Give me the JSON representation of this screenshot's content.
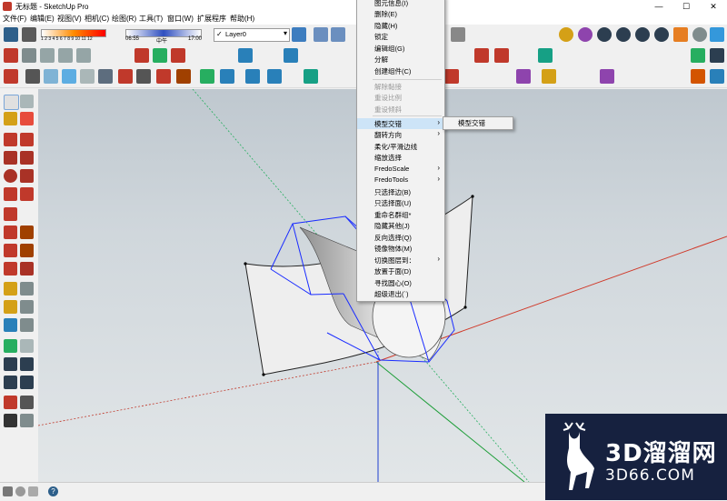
{
  "window": {
    "title": "无标题 - SketchUp Pro",
    "controls": [
      "—",
      "☐",
      "✕"
    ]
  },
  "menubar": {
    "items": [
      "文件(F)",
      "编辑(E)",
      "视图(V)",
      "相机(C)",
      "绘图(R)",
      "工具(T)",
      "窗口(W)",
      "扩展程序",
      "帮助(H)"
    ]
  },
  "toolbar": {
    "layer_name": "Layer0",
    "shadow_months": "1 2 3 4 5 6 7 8 9 10 11 12",
    "shadow_time_start": "06:55",
    "shadow_time_mid": "中午",
    "shadow_time_end": "17:00"
  },
  "context_menu": {
    "items": [
      {
        "label": "图元信息(I)",
        "disabled": false
      },
      {
        "label": "删除(E)",
        "disabled": false
      },
      {
        "label": "隐藏(H)",
        "disabled": false
      },
      {
        "label": "锁定",
        "disabled": false
      },
      {
        "label": "编辑组(G)",
        "disabled": false
      },
      {
        "label": "分解",
        "disabled": false
      },
      {
        "label": "创建组件(C)",
        "disabled": false
      },
      {
        "label": "解除黏接",
        "disabled": true
      },
      {
        "label": "重设比例",
        "disabled": true
      },
      {
        "label": "重设倾斜",
        "disabled": true
      },
      {
        "label": "模型交错",
        "disabled": false,
        "submenu": true,
        "highlighted": true
      },
      {
        "label": "翻转方向",
        "disabled": false,
        "submenu": true
      },
      {
        "label": "柔化/平滑边线",
        "disabled": false
      },
      {
        "label": "缩放选择",
        "disabled": false
      },
      {
        "label": "FredoScale",
        "disabled": false,
        "submenu": true
      },
      {
        "label": "FredoTools",
        "disabled": false,
        "submenu": true
      },
      {
        "label": "只选择边(B)",
        "disabled": false
      },
      {
        "label": "只选择面(U)",
        "disabled": false
      },
      {
        "label": "重命名群组*",
        "disabled": false
      },
      {
        "label": "隐藏其他(J)",
        "disabled": false
      },
      {
        "label": "反向选择(Q)",
        "disabled": false
      },
      {
        "label": "镜像物体(M)",
        "disabled": false
      },
      {
        "label": "切换图层到：",
        "disabled": false,
        "submenu": true
      },
      {
        "label": "放置于面(D)",
        "disabled": false
      },
      {
        "label": "寻找圆心(O)",
        "disabled": false
      },
      {
        "label": "超级退出(`)",
        "disabled": false
      }
    ]
  },
  "submenu": {
    "label": "模型交错"
  },
  "watermark": {
    "brand": "3D溜溜网",
    "url": "3D66.COM"
  },
  "colors": {
    "axis_red": "#c0392b",
    "axis_green": "#27ae60",
    "axis_blue": "#1f3fd0",
    "selection_blue": "#1a2cff",
    "menu_highlight": "#cde4f7"
  }
}
